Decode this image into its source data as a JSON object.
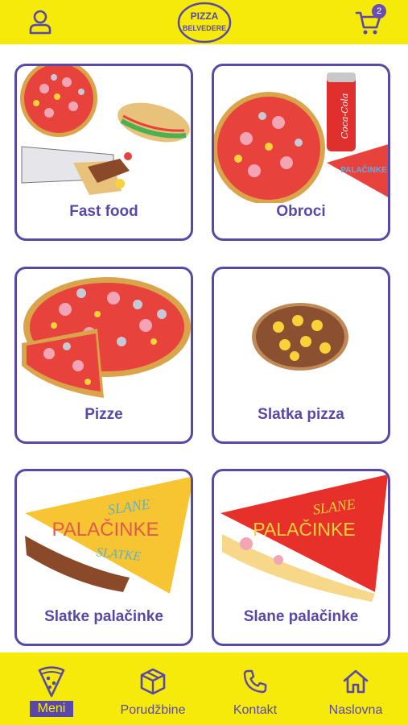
{
  "header": {
    "logo_line1": "PIZZA",
    "logo_line2": "BELVEDERE",
    "cart_count": "2",
    "icons": [
      "user-icon",
      "cart-icon"
    ]
  },
  "menu": {
    "categories": [
      {
        "label": "Fast food"
      },
      {
        "label": "Obroci",
        "can_text": "Coca-Cola",
        "crepe_text": "PALAČINKE"
      },
      {
        "label": "Pizze"
      },
      {
        "label": "Slatka pizza"
      },
      {
        "label": "Slatke palačinke",
        "top_text": "SLANE",
        "main_text": "PALAČINKE",
        "bottom_text": "SLATKE"
      },
      {
        "label": "Slane palačinke",
        "top_text": "SLANE",
        "main_text": "PALAČINKE"
      }
    ]
  },
  "bottom_nav": {
    "items": [
      {
        "label": "Meni",
        "icon": "pizza-slice-icon",
        "active": true
      },
      {
        "label": "Porudžbine",
        "icon": "box-icon"
      },
      {
        "label": "Kontakt",
        "icon": "phone-icon"
      },
      {
        "label": "Naslovna",
        "icon": "home-icon"
      }
    ]
  },
  "colors": {
    "accent": "#5a48a8",
    "bar": "#f5ea0a",
    "pizza_red": "#e8423c",
    "crust": "#d9a44a"
  }
}
